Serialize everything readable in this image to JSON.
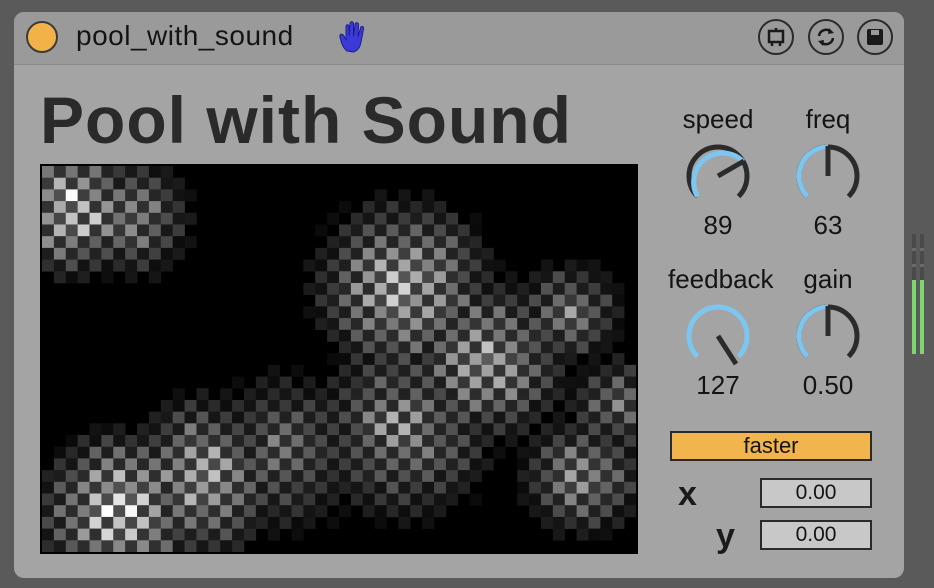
{
  "device": {
    "title": "pool_with_sound",
    "heading": "Pool with Sound",
    "icons": {
      "power": "power-toggle-icon",
      "hand": "hand-icon",
      "freeze": "freeze-device-icon",
      "replace": "hot-swap-icon",
      "save": "save-icon"
    }
  },
  "knobs": [
    {
      "label": "speed",
      "value": "89"
    },
    {
      "label": "freq",
      "value": "63"
    },
    {
      "label": "feedback",
      "value": "127"
    },
    {
      "label": "gain",
      "value": "0.50"
    }
  ],
  "faster_button": {
    "label": "faster"
  },
  "xy": {
    "x_label": "x",
    "x_value": "0.00",
    "y_label": "y",
    "y_value": "0.00"
  },
  "colors": {
    "accent": "#f2b44d",
    "knob_ring": "#7cc6f0",
    "meter": "#7fd66f"
  },
  "meters": {
    "left_level": 0.62,
    "right_level": 0.62
  }
}
